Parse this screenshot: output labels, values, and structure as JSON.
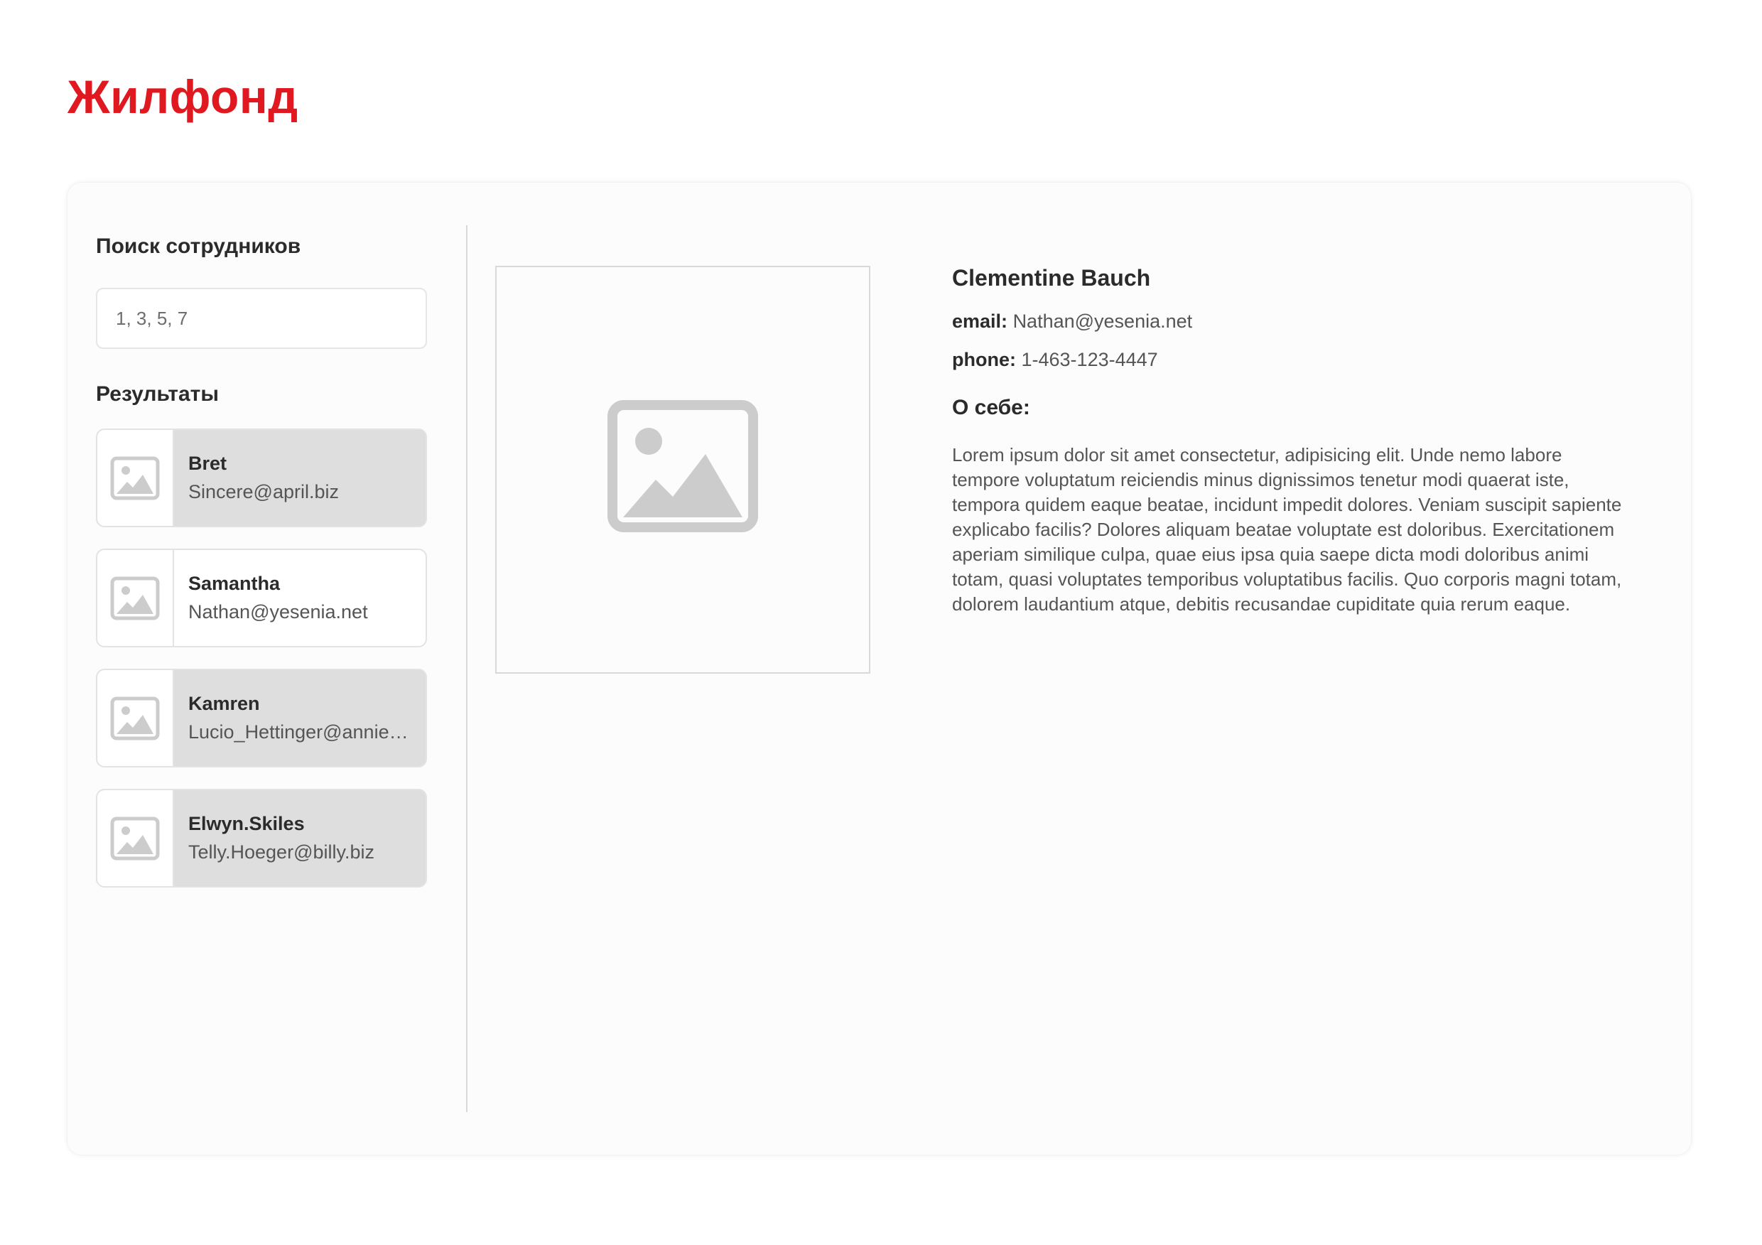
{
  "app": {
    "title": "Жилфонд"
  },
  "search": {
    "title": "Поиск сотрудников",
    "placeholder": "1, 3, 5, 7",
    "value": ""
  },
  "results": {
    "title": "Результаты",
    "items": [
      {
        "name": "Bret",
        "email": "Sincere@april.biz",
        "selected": false,
        "icon": "image-placeholder-icon"
      },
      {
        "name": "Samantha",
        "email": "Nathan@yesenia.net",
        "selected": true,
        "icon": "image-placeholder-icon"
      },
      {
        "name": "Kamren",
        "email": "Lucio_Hettinger@annie.ca",
        "selected": false,
        "icon": "image-placeholder-icon"
      },
      {
        "name": "Elwyn.Skiles",
        "email": "Telly.Hoeger@billy.biz",
        "selected": false,
        "icon": "image-placeholder-icon"
      }
    ]
  },
  "profile": {
    "photo_icon": "image-placeholder-icon",
    "name": "Clementine Bauch",
    "email_label": "email:",
    "email": "Nathan@yesenia.net",
    "phone_label": "phone:",
    "phone": "1-463-123-4447",
    "about_title": "О себе:",
    "about_text": "Lorem ipsum dolor sit amet consectetur, adipisicing elit. Unde nemo labore tempore voluptatum reiciendis minus dignissimos tenetur modi quaerat iste, tempora quidem eaque beatae, incidunt impedit dolores. Veniam suscipit sapiente explicabo facilis? Dolores aliquam beatae voluptate est doloribus. Exercitationem aperiam similique culpa, quae eius ipsa quia saepe dicta modi doloribus animi totam, quasi voluptates temporibus voluptatibus facilis. Quo corporis magni totam, dolorem laudantium atque, debitis recusandae cupiditate quia rerum eaque."
  },
  "colors": {
    "brand": "#e0181f",
    "card_background": "#fcfcfc",
    "result_background": "#dedede",
    "selected_background": "#ffffff",
    "placeholder_icon": "#cccccc"
  }
}
